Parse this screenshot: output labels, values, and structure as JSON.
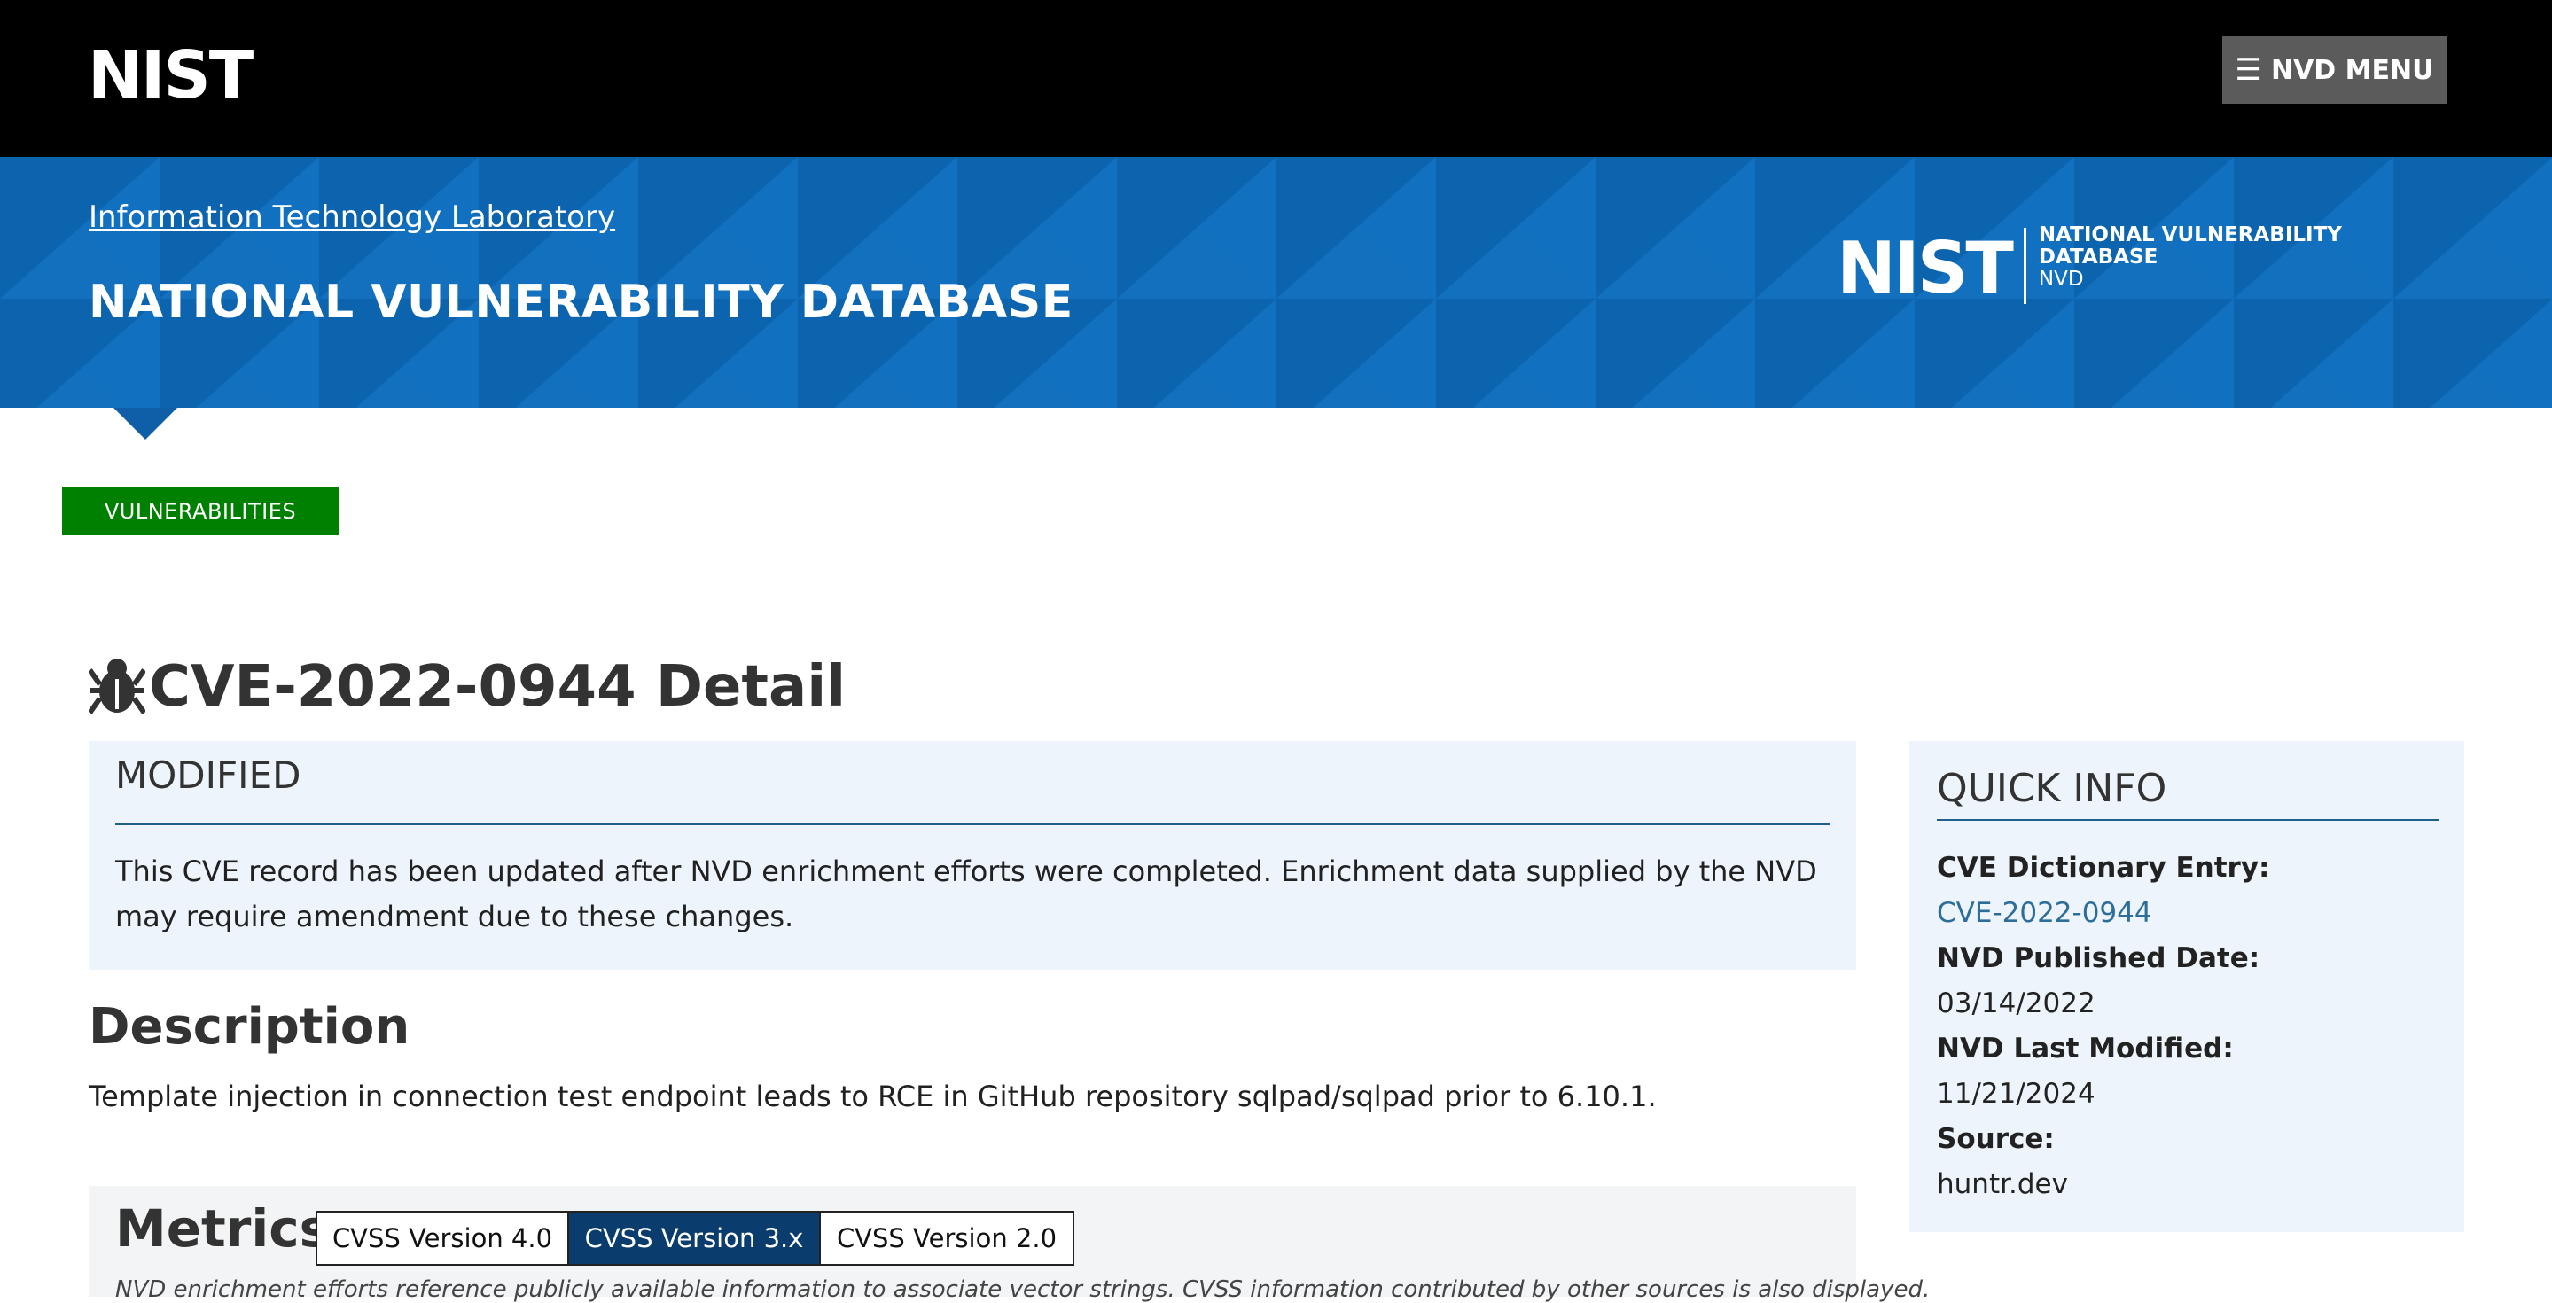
{
  "header": {
    "logo_text": "NIST",
    "menu_icon": "hamburger-icon",
    "menu_label": "NVD MENU"
  },
  "banner": {
    "breadcrumb_link": "Information Technology Laboratory",
    "site_title": "NATIONAL VULNERABILITY DATABASE",
    "logo": {
      "mark": "NIST",
      "line1": "NATIONAL VULNERABILITY",
      "line2": "DATABASE",
      "line3": "NVD"
    },
    "color": "#0e6bb8"
  },
  "section_button": {
    "label": "VULNERABILITIES",
    "color": "#008000"
  },
  "page": {
    "title_icon": "bug-icon",
    "title": "CVE-2022-0944 Detail"
  },
  "modified": {
    "heading": "MODIFIED",
    "body": "This CVE record has been updated after NVD enrichment efforts were completed. Enrichment data supplied by the NVD may require amendment due to these changes."
  },
  "description": {
    "heading": "Description",
    "body": "Template injection in connection test endpoint leads to RCE in GitHub repository sqlpad/sqlpad prior to 6.10.1."
  },
  "metrics": {
    "heading": "Metrics",
    "tabs": [
      {
        "label": "CVSS Version 4.0",
        "active": false
      },
      {
        "label": "CVSS Version 3.x",
        "active": true
      },
      {
        "label": "CVSS Version 2.0",
        "active": false
      }
    ],
    "note": "NVD enrichment efforts reference publicly available information to associate vector strings. CVSS information contributed by other sources is also displayed."
  },
  "quick_info": {
    "heading": "QUICK INFO",
    "cve_entry_label": "CVE Dictionary Entry:",
    "cve_entry_value": "CVE-2022-0944",
    "published_label": "NVD Published Date:",
    "published_value": "03/14/2022",
    "modified_label": "NVD Last Modified:",
    "modified_value": "11/21/2024",
    "source_label": "Source:",
    "source_value": "huntr.dev"
  }
}
